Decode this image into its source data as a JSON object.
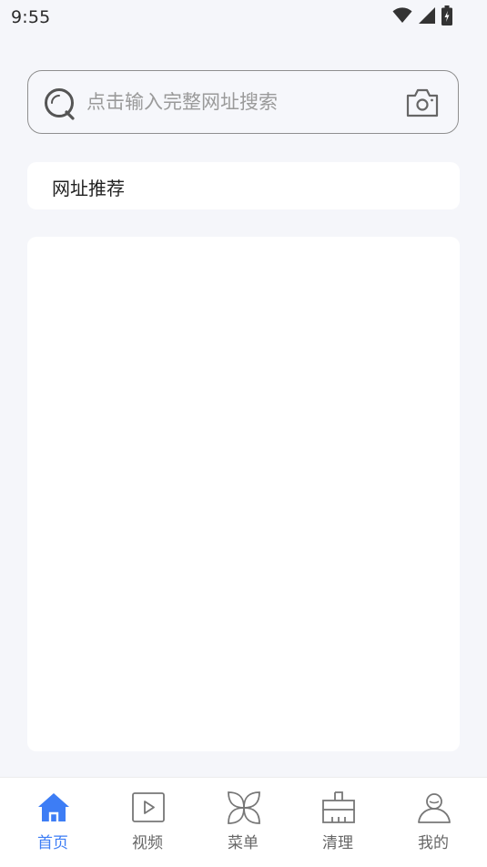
{
  "status_bar": {
    "time": "9:55",
    "icons": [
      "wifi-icon",
      "cellular-signal-icon",
      "battery-charging-icon"
    ]
  },
  "search": {
    "placeholder": "点击输入完整网址搜索",
    "value": "",
    "leading_icon": "search-icon",
    "trailing_icon": "camera-icon"
  },
  "recommend": {
    "title": "网址推荐"
  },
  "tab_bar": {
    "active_color": "#3d7df5",
    "inactive_color": "#666666",
    "tabs": [
      {
        "label": "首页",
        "icon": "home-icon",
        "active": true
      },
      {
        "label": "视频",
        "icon": "video-play-icon",
        "active": false
      },
      {
        "label": "菜单",
        "icon": "menu-grid-icon",
        "active": false
      },
      {
        "label": "清理",
        "icon": "broom-icon",
        "active": false
      },
      {
        "label": "我的",
        "icon": "user-icon",
        "active": false
      }
    ]
  }
}
